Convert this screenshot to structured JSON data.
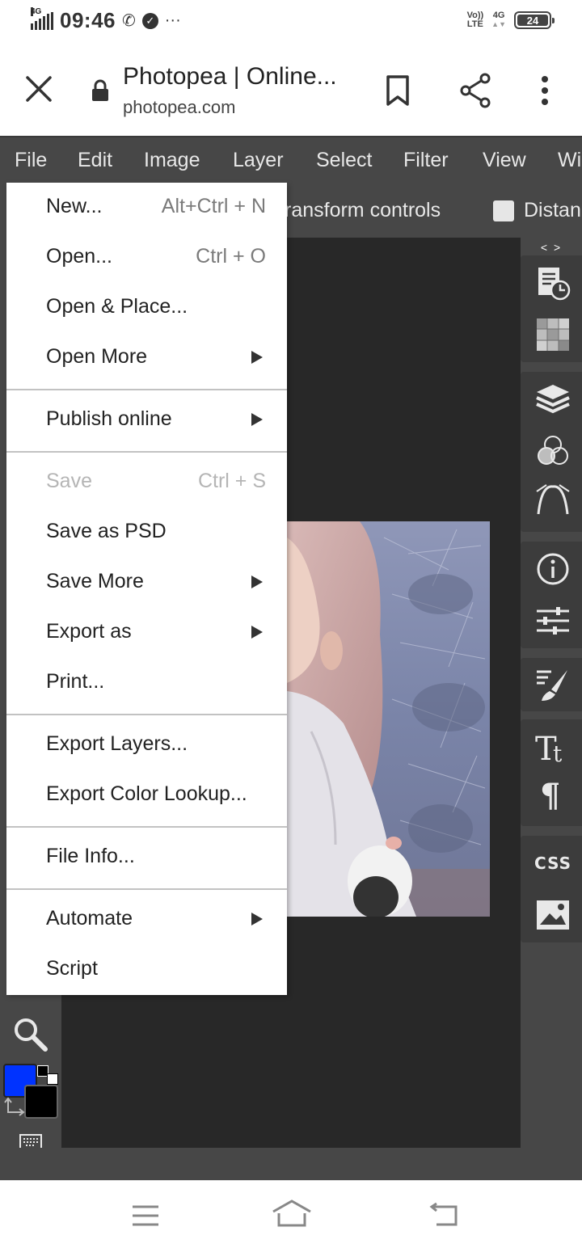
{
  "status_bar": {
    "network": "4G",
    "time": "09:46",
    "more": "···",
    "volte": "Vo)) LTE",
    "volte_line1": "Vo))",
    "volte_line2": "LTE",
    "net_right": "4G",
    "battery": "24"
  },
  "browser": {
    "title": "Photopea | Online...",
    "url": "photopea.com"
  },
  "menubar": {
    "items": [
      "File",
      "Edit",
      "Image",
      "Layer",
      "Select",
      "Filter",
      "View",
      "Wi"
    ]
  },
  "options_bar": {
    "transform_label": "ransform controls",
    "distance_label": "Distan"
  },
  "right_panel": {
    "toggle": "< >",
    "css_label": "CSS"
  },
  "colors": {
    "foreground": "#0033ff",
    "background": "#000000",
    "app_bg": "#474747",
    "canvas_bg": "#282828"
  },
  "file_menu": {
    "items": [
      {
        "label": "New...",
        "shortcut": "Alt+Ctrl + N"
      },
      {
        "label": "Open...",
        "shortcut": "Ctrl + O"
      },
      {
        "label": "Open & Place..."
      },
      {
        "label": "Open More",
        "submenu": true
      },
      {
        "label": "Publish online",
        "submenu": true
      },
      {
        "label": "Save",
        "shortcut": "Ctrl + S",
        "disabled": true
      },
      {
        "label": "Save as PSD"
      },
      {
        "label": "Save More",
        "submenu": true
      },
      {
        "label": "Export as",
        "submenu": true
      },
      {
        "label": "Print..."
      },
      {
        "label": "Export Layers..."
      },
      {
        "label": "Export Color Lookup..."
      },
      {
        "label": "File Info..."
      },
      {
        "label": "Automate",
        "submenu": true
      },
      {
        "label": "Script"
      }
    ]
  }
}
